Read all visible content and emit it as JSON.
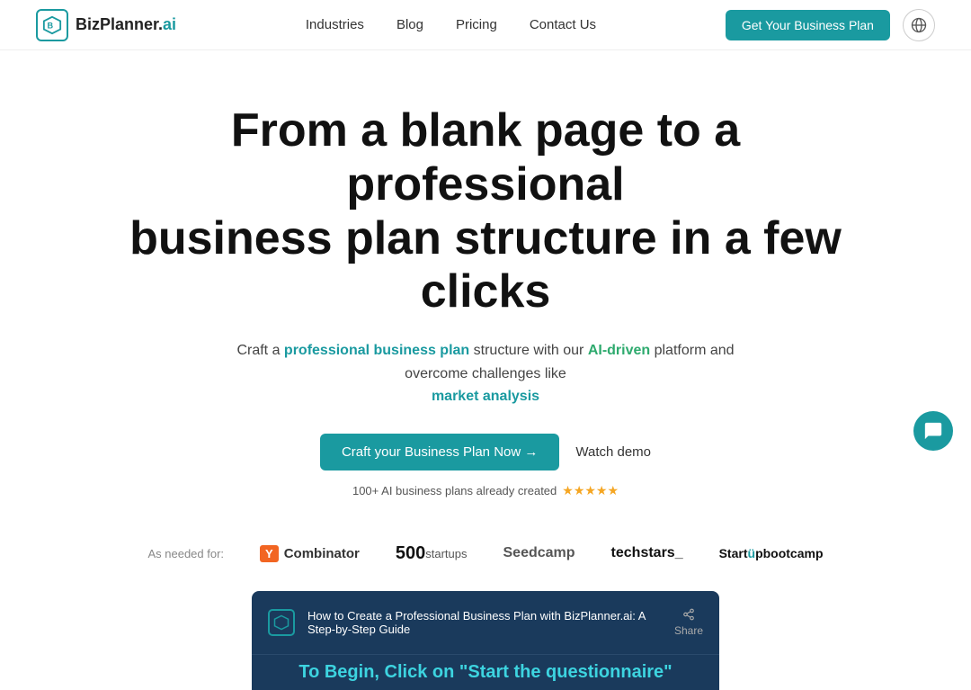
{
  "navbar": {
    "brand": "BizPlanner.",
    "brand_ai": "ai",
    "nav_items": [
      "Industries",
      "Blog",
      "Pricing",
      "Contact Us"
    ],
    "cta_label": "Get Your Business Plan"
  },
  "hero": {
    "title_line1": "From a blank page to a professional",
    "title_line2": "business plan structure in a few clicks",
    "subtitle_pre": "Craft a ",
    "subtitle_highlight1": "professional business plan",
    "subtitle_mid": " structure with our ",
    "subtitle_highlight2": "AI-driven",
    "subtitle_post": " platform and overcome challenges like",
    "subtitle_highlight3": "market analysis",
    "cta_label": "Craft your Business Plan Now →",
    "watch_demo_label": "Watch demo",
    "social_proof": "100+ AI business plans already created",
    "stars": "★★★★★"
  },
  "logos": {
    "label": "As needed for:",
    "items": [
      {
        "name": "Y Combinator",
        "type": "yc"
      },
      {
        "name": "500 Startups",
        "type": "500"
      },
      {
        "name": "Seedcamp",
        "type": "seedcamp"
      },
      {
        "name": "Techstars",
        "type": "techstars"
      },
      {
        "name": "Startup Bootcamp",
        "type": "startupbootcamp"
      }
    ]
  },
  "video": {
    "title": "How to Create a Professional Business Plan with BizPlanner.ai: A Step-by-Step Guide",
    "bottom_text": "To Begin, Click on \"Start the questionnaire\"",
    "share_label": "Share"
  },
  "chat": {
    "label": "chat"
  }
}
